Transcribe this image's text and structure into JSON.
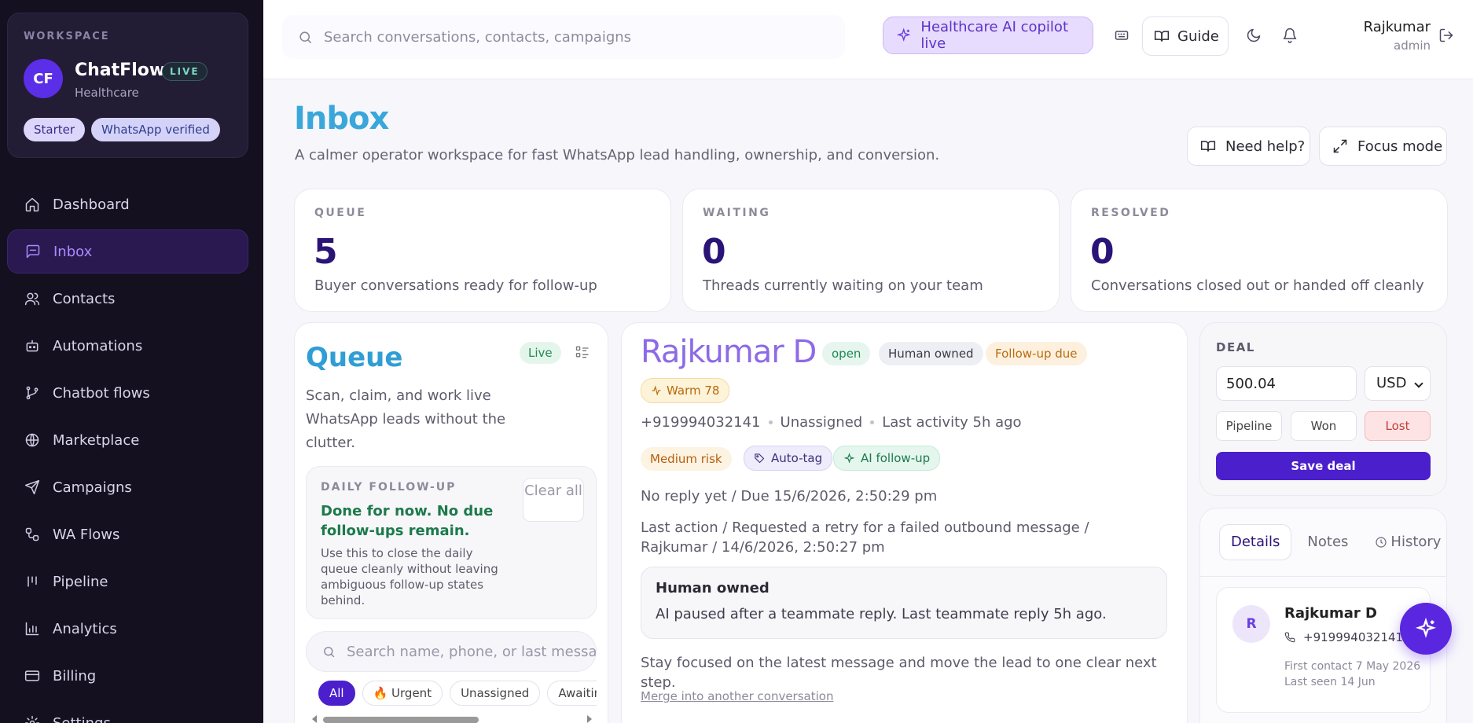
{
  "workspace": {
    "label": "WORKSPACE",
    "initials": "CF",
    "name": "ChatFlow",
    "live": "LIVE",
    "industry": "Healthcare",
    "plan": "Starter",
    "verification": "WhatsApp verified"
  },
  "nav": [
    {
      "label": "Dashboard",
      "icon": "home-icon",
      "active": false
    },
    {
      "label": "Inbox",
      "icon": "message-square-icon",
      "active": true
    },
    {
      "label": "Contacts",
      "icon": "users-icon",
      "active": false
    },
    {
      "label": "Automations",
      "icon": "bot-icon",
      "active": false
    },
    {
      "label": "Chatbot flows",
      "icon": "git-branch-icon",
      "active": false
    },
    {
      "label": "Marketplace",
      "icon": "globe-icon",
      "active": false
    },
    {
      "label": "Campaigns",
      "icon": "send-icon",
      "active": false
    },
    {
      "label": "WA Flows",
      "icon": "workflow-icon",
      "active": false
    },
    {
      "label": "Pipeline",
      "icon": "kanban-icon",
      "active": false
    },
    {
      "label": "Analytics",
      "icon": "bar-chart-icon",
      "active": false
    },
    {
      "label": "Billing",
      "icon": "credit-card-icon",
      "active": false
    },
    {
      "label": "Settings",
      "icon": "settings-icon",
      "active": false
    }
  ],
  "topbar": {
    "search_placeholder": "Search conversations, contacts, campaigns",
    "copilot": "Healthcare AI copilot live",
    "guide": "Guide",
    "user_name": "Rajkumar",
    "user_role": "admin"
  },
  "page": {
    "title": "Inbox",
    "subtitle": "A calmer operator workspace for fast WhatsApp lead handling, ownership, and conversion.",
    "help": "Need help?",
    "focus": "Focus mode"
  },
  "stats": [
    {
      "label": "QUEUE",
      "value": "5",
      "desc": "Buyer conversations ready for follow-up"
    },
    {
      "label": "WAITING",
      "value": "0",
      "desc": "Threads currently waiting on your team"
    },
    {
      "label": "RESOLVED",
      "value": "0",
      "desc": "Conversations closed out or handed off cleanly"
    }
  ],
  "queue": {
    "title": "Queue",
    "live": "Live",
    "desc": "Scan, claim, and work live WhatsApp leads without the clutter.",
    "daily_label": "DAILY FOLLOW-UP",
    "daily_head": "Done for now. No due follow-ups remain.",
    "daily_body": "Use this to close the daily queue cleanly without leaving ambiguous follow-up states behind.",
    "clear_all": "Clear all",
    "search_placeholder": "Search name, phone, or last message",
    "chips": [
      "All",
      "🔥 Urgent",
      "Unassigned",
      "Awaiting"
    ]
  },
  "conversation": {
    "name": "Rajkumar D",
    "status": "open",
    "owner_badge": "Human owned",
    "followup_badge": "Follow-up due",
    "warm": "Warm 78",
    "phone": "+919994032141",
    "assignee": "Unassigned",
    "last_activity": "Last activity 5h ago",
    "risk": "Medium risk",
    "autotag": "Auto-tag",
    "ai_followup": "AI follow-up",
    "reply_status": "No reply yet / Due 15/6/2026, 2:50:29 pm",
    "last_action": "Last action / Requested a retry for a failed outbound message / Rajkumar / 14/6/2026, 2:50:27 pm",
    "owned_title": "Human owned",
    "owned_text": "AI paused after a teammate reply. Last teammate reply 5h ago.",
    "focus_hint": "Stay focused on the latest message and move the lead to one clear next step.",
    "merge": "Merge into another conversation"
  },
  "deal": {
    "label": "DEAL",
    "amount": "500.04",
    "currency": "USD",
    "stages": [
      "Pipeline",
      "Won",
      "Lost"
    ],
    "save": "Save deal"
  },
  "details": {
    "tabs": [
      "Details",
      "Notes",
      "History"
    ],
    "initial": "R",
    "name": "Rajkumar D",
    "phone": "+919994032141",
    "first_contact": "First contact 7 May 2026",
    "last_seen": "Last seen 14 Jun"
  },
  "colors": {
    "accent": "#4b1fcc",
    "sidebar_bg": "#14101f",
    "title_blue": "#39a7d9"
  }
}
